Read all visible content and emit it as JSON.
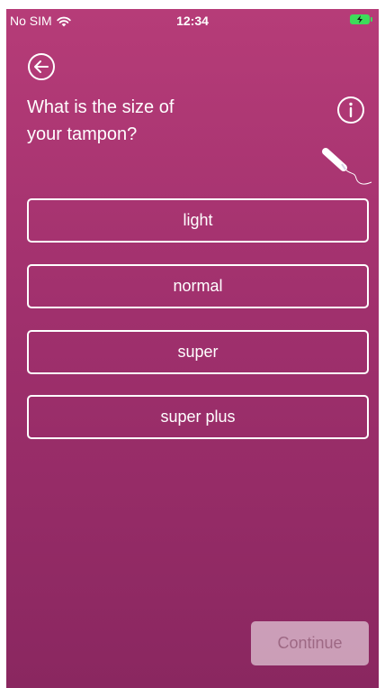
{
  "status_bar": {
    "carrier": "No SIM",
    "time": "12:34",
    "wifi_icon": "wifi-icon",
    "battery_icon": "battery-charging-icon",
    "battery_color": "#3ddc5a"
  },
  "header": {
    "back_icon": "arrow-left-circle-icon",
    "info_icon": "info-circle-icon",
    "illustration_icon": "tampon-icon"
  },
  "question": {
    "line1": "What is the size of",
    "line2": "your tampon?"
  },
  "options": [
    {
      "label": "light"
    },
    {
      "label": "normal"
    },
    {
      "label": "super"
    },
    {
      "label": "super plus"
    }
  ],
  "footer": {
    "continue_label": "Continue",
    "continue_enabled": false
  },
  "colors": {
    "background_top": "#b63c78",
    "background_bottom": "#8a2760",
    "foreground": "#ffffff"
  }
}
